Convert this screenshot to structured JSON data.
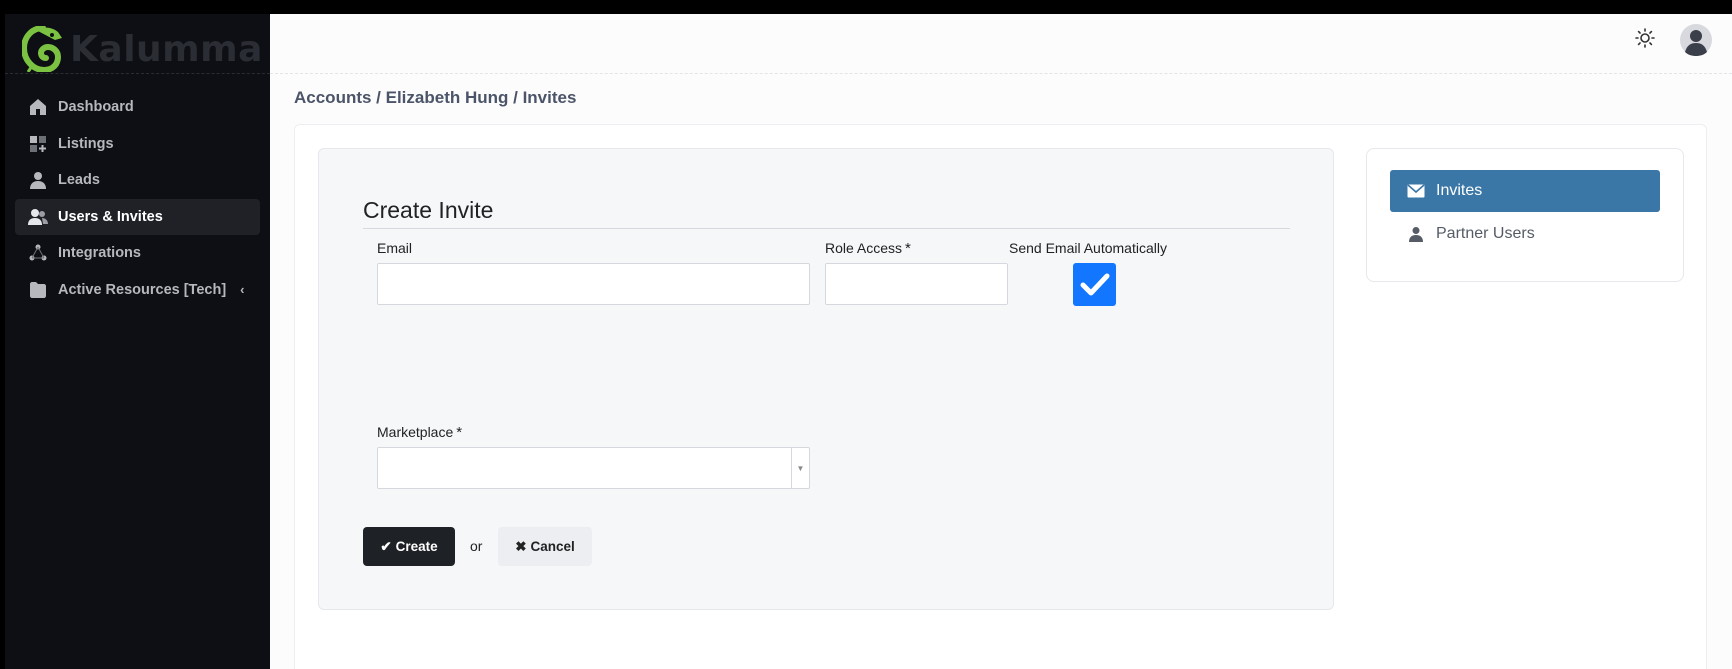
{
  "app": {
    "brand": "Kalumma",
    "brand_color": "#7cc242"
  },
  "sidebar": {
    "items": [
      {
        "label": "Dashboard",
        "icon": "home-icon"
      },
      {
        "label": "Listings",
        "icon": "grid-plus-icon"
      },
      {
        "label": "Leads",
        "icon": "user-icon"
      },
      {
        "label": "Users & Invites",
        "icon": "users-icon",
        "active": true
      },
      {
        "label": "Integrations",
        "icon": "nodes-icon"
      },
      {
        "label": "Active Resources [Tech]",
        "icon": "folder-icon",
        "chevron": "‹"
      }
    ]
  },
  "header": {
    "theme_icon": "sun-icon",
    "avatar_icon": "user-avatar-icon"
  },
  "breadcrumb": "Accounts / Elizabeth Hung / Invites",
  "form": {
    "title": "Create Invite",
    "email_label": "Email",
    "email_value": "",
    "role_label": "Role Access",
    "role_value": "",
    "required_mark": "*",
    "send_email_label": "Send Email Automatically",
    "send_email_checked": true,
    "marketplace_label": "Marketplace",
    "marketplace_value": "",
    "create_label": "Create",
    "or_text": "or",
    "cancel_label": "Cancel",
    "accent_color": "#1276ff"
  },
  "side_nav": {
    "items": [
      {
        "label": "Invites",
        "icon": "envelope-icon",
        "active": true
      },
      {
        "label": "Partner Users",
        "icon": "user-icon"
      }
    ],
    "active_color": "#3a77a6"
  }
}
